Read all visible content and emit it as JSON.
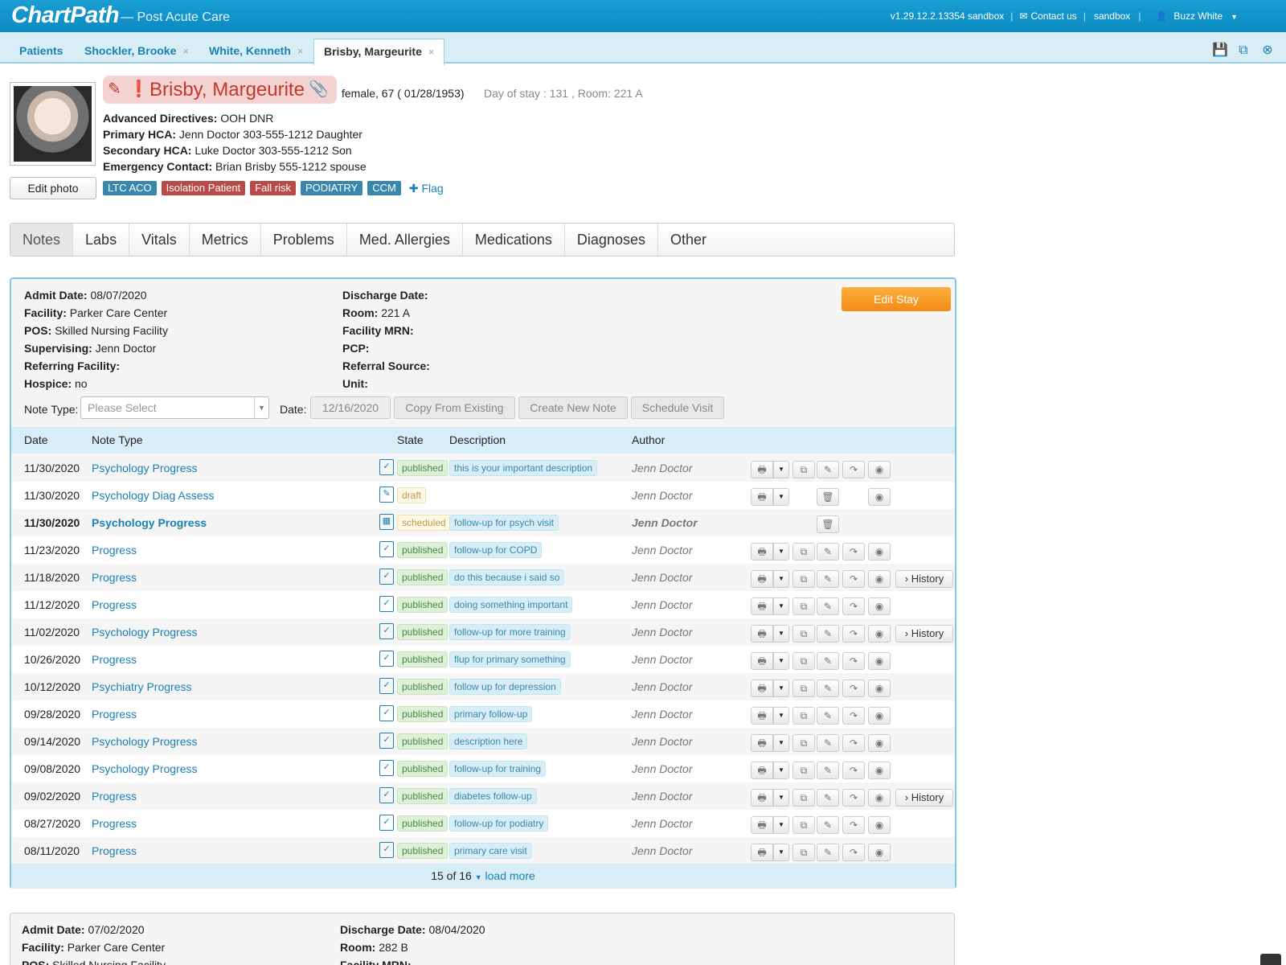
{
  "app": {
    "logo": "ChartPath",
    "subtitle": "— Post Acute Care",
    "version": "v1.29.12.2.13354 sandbox",
    "contact": "Contact us",
    "env": "sandbox",
    "user": "Buzz White"
  },
  "patient_tabs": [
    {
      "label": "Patients"
    },
    {
      "label": "Shockler, Brooke"
    },
    {
      "label": "White, Kenneth"
    },
    {
      "label": "Brisby, Margeurite"
    }
  ],
  "patient": {
    "name": "Brisby, Margeurite",
    "demographics": "female, 67 ( 01/28/1953)",
    "stay": "Day of stay : 131 , Room: 221 A",
    "edit_photo": "Edit photo",
    "details": [
      {
        "label": "Advanced Directives:",
        "value": "OOH DNR"
      },
      {
        "label": "Primary HCA:",
        "value": "Jenn Doctor 303-555-1212 Daughter"
      },
      {
        "label": "Secondary HCA:",
        "value": "Luke Doctor 303-555-1212 Son"
      },
      {
        "label": "Emergency Contact:",
        "value": "Brian Brisby 555-1212 spouse"
      }
    ],
    "flags": [
      {
        "label": "LTC ACO",
        "color": "#3a87ad"
      },
      {
        "label": "Isolation Patient",
        "color": "#b94a48"
      },
      {
        "label": "Fall risk",
        "color": "#b94a48"
      },
      {
        "label": "PODIATRY",
        "color": "#3a87ad"
      },
      {
        "label": "CCM",
        "color": "#3a87ad"
      }
    ],
    "add_flag": "Flag"
  },
  "main_tabs": [
    "Notes",
    "Labs",
    "Vitals",
    "Metrics",
    "Problems",
    "Med. Allergies",
    "Medications",
    "Diagnoses",
    "Other"
  ],
  "stay1": {
    "left": [
      {
        "label": "Admit Date:",
        "value": "08/07/2020"
      },
      {
        "label": "Facility:",
        "value": "Parker Care Center"
      },
      {
        "label": "POS:",
        "value": "Skilled Nursing Facility"
      },
      {
        "label": "Supervising:",
        "value": "Jenn Doctor"
      },
      {
        "label": "Referring Facility:",
        "value": ""
      },
      {
        "label": "Hospice:",
        "value": "no"
      }
    ],
    "right": [
      {
        "label": "Discharge Date:",
        "value": ""
      },
      {
        "label": "Room:",
        "value": "221 A"
      },
      {
        "label": "Facility MRN:",
        "value": ""
      },
      {
        "label": "PCP:",
        "value": ""
      },
      {
        "label": "Referral Source:",
        "value": ""
      },
      {
        "label": "Unit:",
        "value": ""
      }
    ],
    "edit_stay": "Edit Stay",
    "note_type_label": "Note Type:",
    "note_type_placeholder": "Please Select",
    "date_label": "Date:",
    "date_value": "12/16/2020",
    "copy_btn": "Copy From Existing",
    "create_btn": "Create New Note",
    "schedule_btn": "Schedule Visit",
    "headers": {
      "date": "Date",
      "type": "Note Type",
      "state": "State",
      "desc": "Description",
      "author": "Author"
    },
    "notes": [
      {
        "date": "11/30/2020",
        "type": "Psychology Progress",
        "state": "published",
        "desc": "this is your important description",
        "author": "Jenn Doctor"
      },
      {
        "date": "11/30/2020",
        "type": "Psychology Diag Assess",
        "state": "draft",
        "desc": "",
        "author": "Jenn Doctor"
      },
      {
        "date": "11/30/2020",
        "type": "Psychology Progress",
        "state": "scheduled",
        "desc": "follow-up for psych visit",
        "author": "Jenn Doctor"
      },
      {
        "date": "11/23/2020",
        "type": "Progress",
        "state": "published",
        "desc": "follow-up for COPD",
        "author": "Jenn Doctor"
      },
      {
        "date": "11/18/2020",
        "type": "Progress",
        "state": "published",
        "desc": "do this because i said so",
        "author": "Jenn Doctor",
        "history": "History"
      },
      {
        "date": "11/12/2020",
        "type": "Progress",
        "state": "published",
        "desc": "doing something important",
        "author": "Jenn Doctor"
      },
      {
        "date": "11/02/2020",
        "type": "Psychology Progress",
        "state": "published",
        "desc": "follow-up for more training",
        "author": "Jenn Doctor",
        "history": "History"
      },
      {
        "date": "10/26/2020",
        "type": "Progress",
        "state": "published",
        "desc": "flup for primary something",
        "author": "Jenn Doctor"
      },
      {
        "date": "10/12/2020",
        "type": "Psychiatry Progress",
        "state": "published",
        "desc": "follow up for depression",
        "author": "Jenn Doctor"
      },
      {
        "date": "09/28/2020",
        "type": "Progress",
        "state": "published",
        "desc": "primary follow-up",
        "author": "Jenn Doctor"
      },
      {
        "date": "09/14/2020",
        "type": "Psychology Progress",
        "state": "published",
        "desc": "description here",
        "author": "Jenn Doctor"
      },
      {
        "date": "09/08/2020",
        "type": "Psychology Progress",
        "state": "published",
        "desc": "follow-up for training",
        "author": "Jenn Doctor"
      },
      {
        "date": "09/02/2020",
        "type": "Progress",
        "state": "published",
        "desc": "diabetes follow-up",
        "author": "Jenn Doctor",
        "history": "History"
      },
      {
        "date": "08/27/2020",
        "type": "Progress",
        "state": "published",
        "desc": "follow-up for podiatry",
        "author": "Jenn Doctor"
      },
      {
        "date": "08/11/2020",
        "type": "Progress",
        "state": "published",
        "desc": "primary care visit",
        "author": "Jenn Doctor"
      }
    ],
    "pager_count": "15 of 16",
    "pager_more": "load more"
  },
  "stay2": {
    "left": [
      {
        "label": "Admit Date:",
        "value": "07/02/2020"
      },
      {
        "label": "Facility:",
        "value": "Parker Care Center"
      },
      {
        "label": "POS:",
        "value": "Skilled Nursing Facility"
      }
    ],
    "right": [
      {
        "label": "Discharge Date:",
        "value": "08/04/2020"
      },
      {
        "label": "Room:",
        "value": "282 B"
      },
      {
        "label": "Facility MRN:",
        "value": ""
      }
    ]
  }
}
